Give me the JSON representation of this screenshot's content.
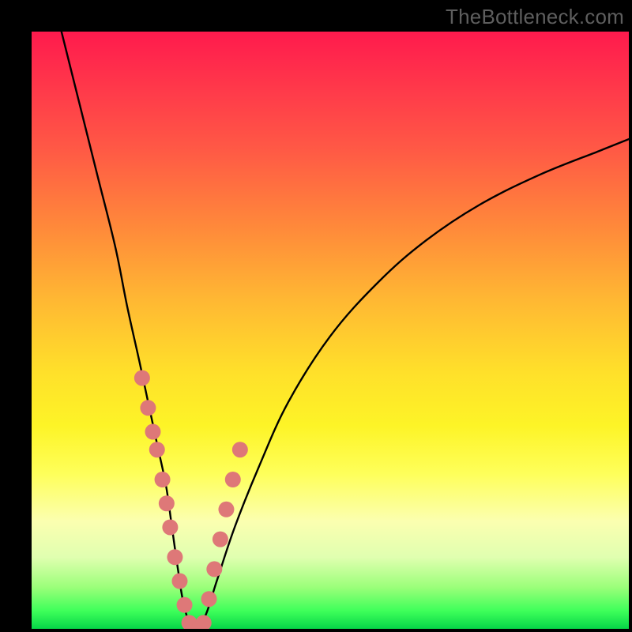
{
  "watermark": "TheBottleneck.com",
  "chart_data": {
    "type": "line",
    "title": "",
    "xlabel": "",
    "ylabel": "",
    "xlim": [
      0,
      100
    ],
    "ylim": [
      0,
      100
    ],
    "grid": false,
    "legend": false,
    "series": [
      {
        "name": "bottleneck-curve",
        "x": [
          5,
          8,
          11,
          14,
          16,
          18,
          19.5,
          21,
          22.5,
          23.5,
          24.5,
          25.5,
          27,
          29,
          31,
          34,
          38,
          43,
          50,
          58,
          66,
          75,
          85,
          95,
          100
        ],
        "values": [
          100,
          88,
          76,
          64,
          54,
          45,
          38,
          31,
          24,
          17,
          10,
          4,
          0,
          2,
          8,
          17,
          27,
          38,
          49,
          58,
          65,
          71,
          76,
          80,
          82
        ]
      }
    ],
    "markers": {
      "name": "highlight-points",
      "x": [
        18.5,
        19.5,
        20.3,
        21.0,
        21.9,
        22.6,
        23.2,
        24.0,
        24.8,
        25.6,
        26.4,
        27.2,
        28.0,
        28.8,
        29.7,
        30.6,
        31.6,
        32.6,
        33.7,
        34.9
      ],
      "values": [
        42,
        37,
        33,
        30,
        25,
        21,
        17,
        12,
        8,
        4,
        1,
        0,
        0,
        1,
        5,
        10,
        15,
        20,
        25,
        30
      ]
    },
    "background_gradient": {
      "top": "#ff1a4d",
      "mid": "#ffe02a",
      "bottom": "#06d648"
    }
  }
}
